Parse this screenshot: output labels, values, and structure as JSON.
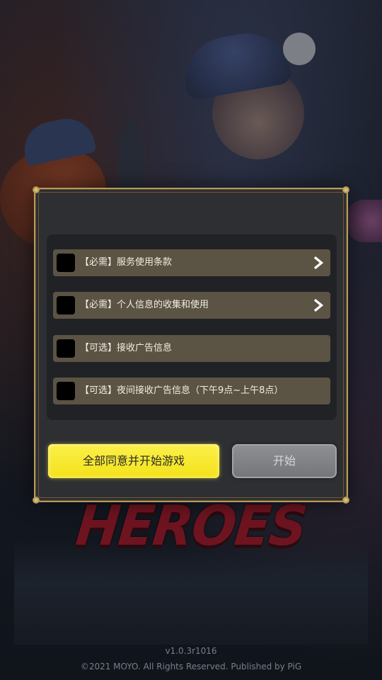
{
  "dialog": {
    "title": "",
    "items": [
      {
        "label": "【必需】服务使用条款",
        "checked": false,
        "has_arrow": true
      },
      {
        "label": "【必需】个人信息的收集和使用",
        "checked": false,
        "has_arrow": true
      },
      {
        "label": "【可选】接收广告信息",
        "checked": false,
        "has_arrow": false
      },
      {
        "label": "【可选】夜间接收广告信息（下午9点~上午8点）",
        "checked": false,
        "has_arrow": false
      }
    ],
    "agree_all_button": "全部同意并开始游戏",
    "start_button": "开始"
  },
  "background": {
    "logo_text": "HEROES"
  },
  "footer": {
    "version": "v1.0.3r1016",
    "copyright": "©2021 MOYO. All Rights Reserved. Published by PiG"
  },
  "colors": {
    "accent_yellow": "#f3e21a",
    "row_bg": "#5b5344",
    "frame_gold": "#b69a5e",
    "disabled_button": "#7f8185"
  },
  "icons": {
    "item_arrow": "chevron-right-icon",
    "checkbox": "checkbox-unchecked"
  }
}
